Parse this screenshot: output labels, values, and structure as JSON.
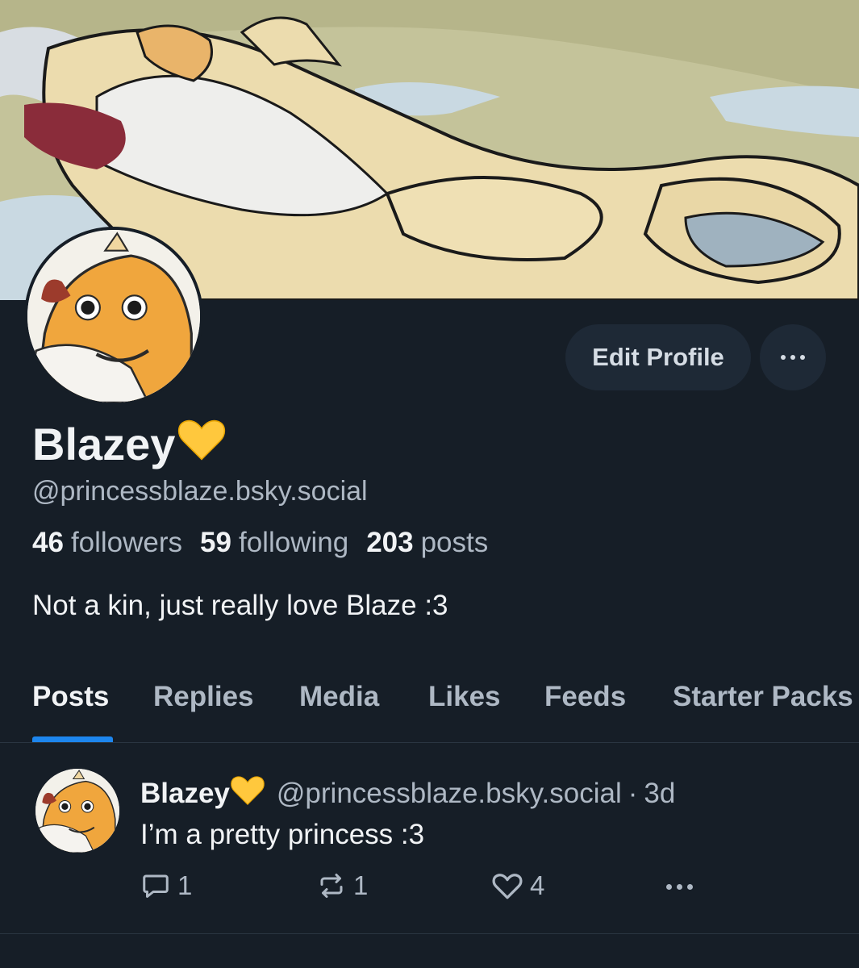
{
  "profile": {
    "display_name": "Blazey",
    "name_emoji": "yellow-heart",
    "handle": "@princessblaze.bsky.social",
    "stats": {
      "followers_count": "46",
      "followers_label": "followers",
      "following_count": "59",
      "following_label": "following",
      "posts_count": "203",
      "posts_label": "posts"
    },
    "bio": "Not a kin, just really love Blaze :3"
  },
  "actions": {
    "edit_profile_label": "Edit Profile",
    "more_icon": "ellipsis-icon"
  },
  "tabs": [
    {
      "label": "Posts",
      "active": true
    },
    {
      "label": "Replies",
      "active": false
    },
    {
      "label": "Media",
      "active": false
    },
    {
      "label": "Likes",
      "active": false
    },
    {
      "label": "Feeds",
      "active": false
    },
    {
      "label": "Starter Packs",
      "active": false
    }
  ],
  "post": {
    "author_name": "Blazey",
    "author_handle": "@princessblaze.bsky.social",
    "separator": "·",
    "time": "3d",
    "text": "I’m a pretty princess :3",
    "reply_count": "1",
    "repost_count": "1",
    "like_count": "4"
  },
  "colors": {
    "background": "#161e27",
    "accent": "#1d86ee",
    "muted_text": "#aeb8c4",
    "button_bg": "#1e2936"
  }
}
